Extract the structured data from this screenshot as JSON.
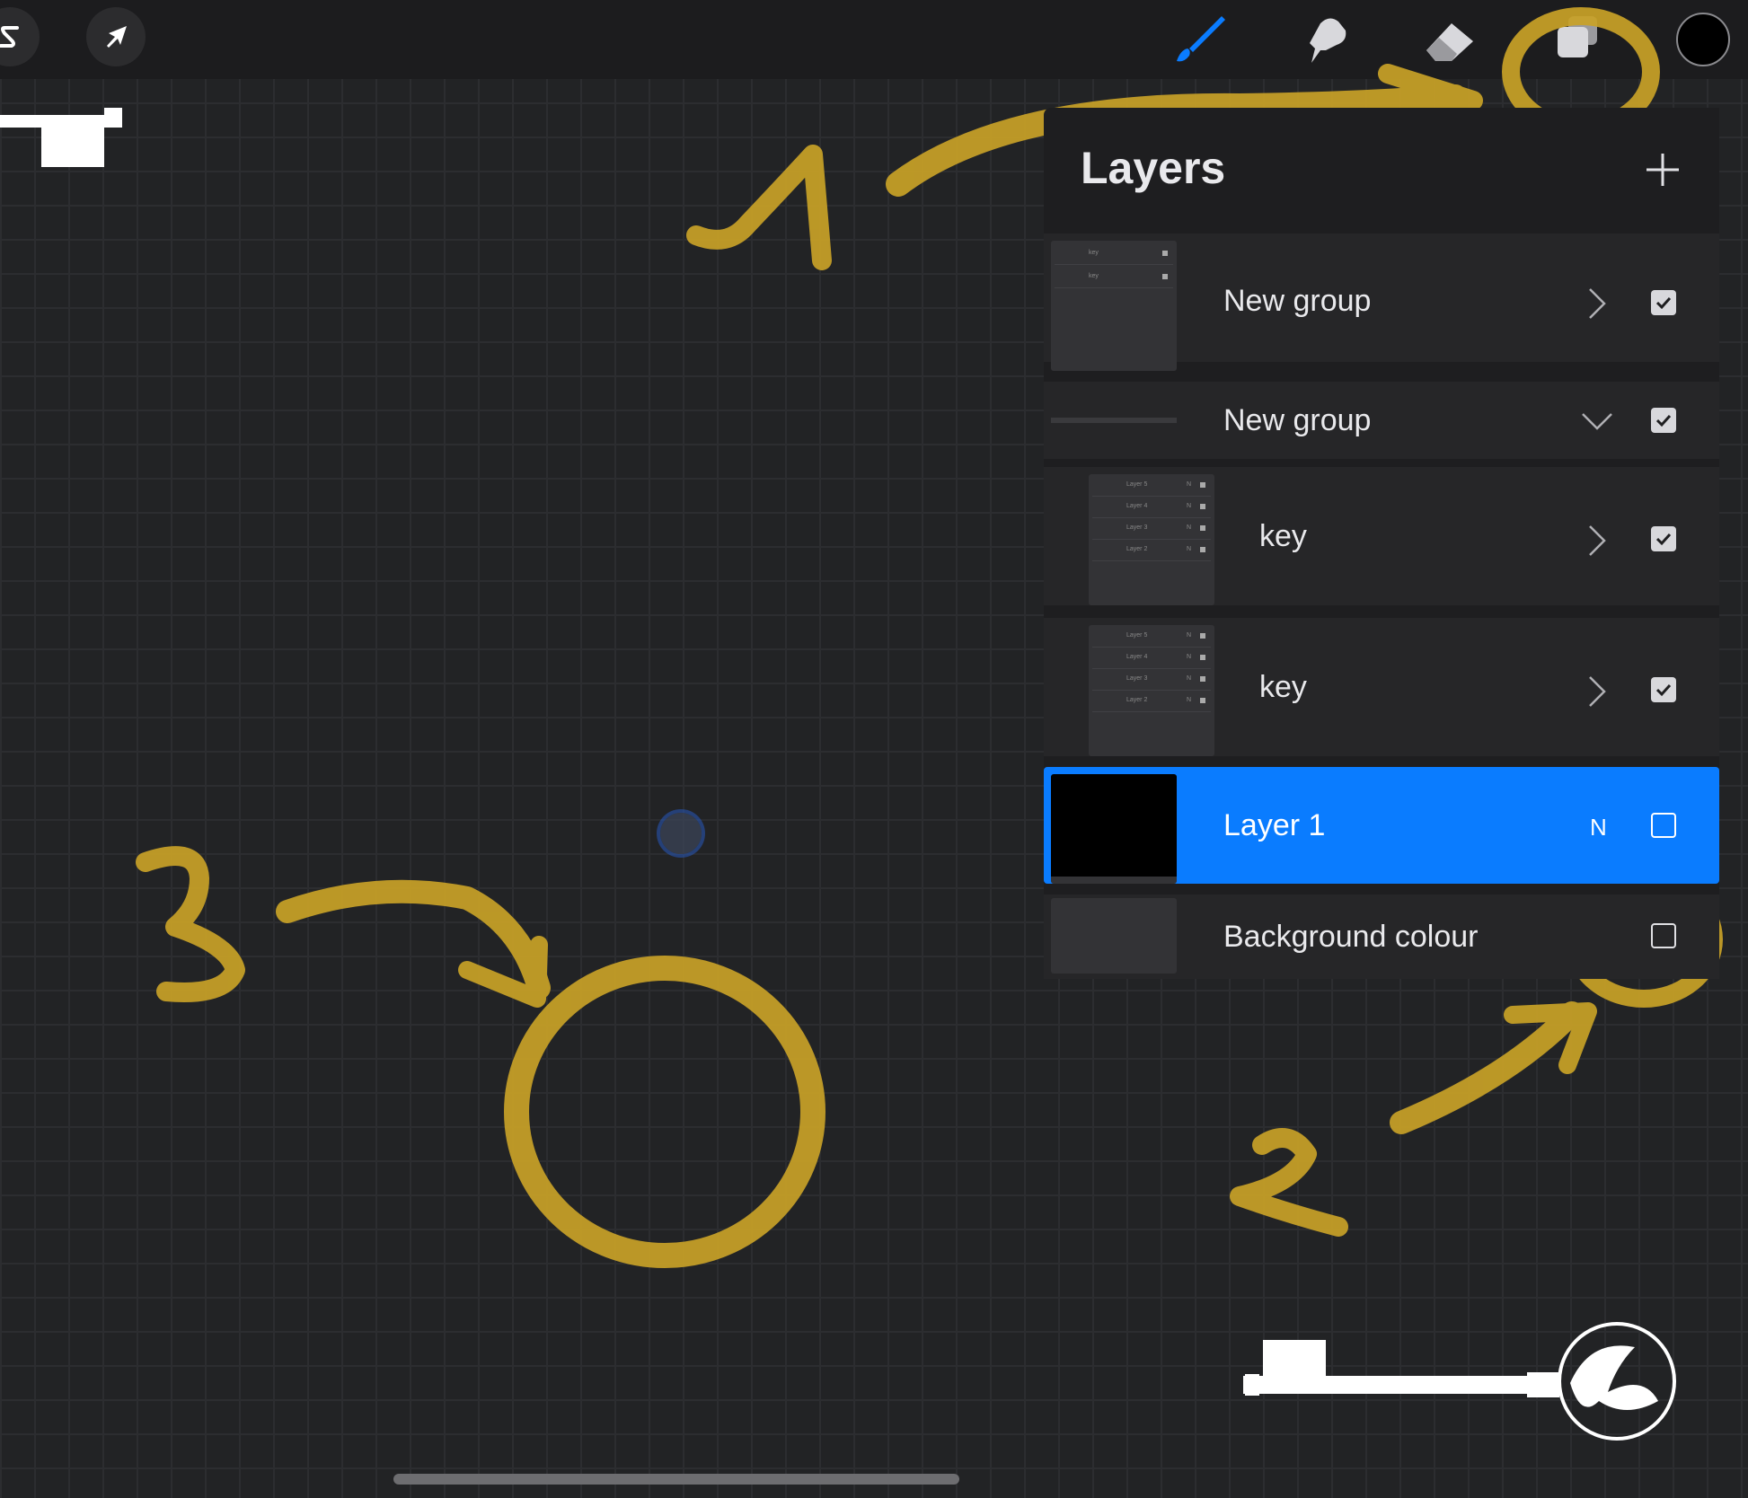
{
  "toolbar": {
    "left_tools": [
      "selection-tool",
      "transform-tool"
    ],
    "right_tools": [
      "brush-tool",
      "smudge-tool",
      "eraser-tool",
      "layers-tool"
    ],
    "active_tool": "brush-tool",
    "current_color": "#000000"
  },
  "layers_panel": {
    "title": "Layers",
    "add_label": "+",
    "layers": [
      {
        "name": "New group",
        "type": "group",
        "expanded": false,
        "visible": true,
        "mini_rows": [
          "key",
          "key"
        ]
      },
      {
        "name": "New group",
        "type": "group",
        "expanded": true,
        "visible": true
      },
      {
        "name": "key",
        "type": "group",
        "expanded": false,
        "visible": true,
        "indent": true,
        "mini_rows": [
          "Layer 5",
          "Layer 4",
          "Layer 3",
          "Layer 2"
        ],
        "mini_n": "N"
      },
      {
        "name": "key",
        "type": "group",
        "expanded": false,
        "visible": true,
        "indent": true,
        "mini_rows": [
          "Layer 5",
          "Layer 4",
          "Layer 3",
          "Layer 2"
        ],
        "mini_n": "N"
      },
      {
        "name": "Layer 1",
        "type": "layer",
        "blend_mode": "N",
        "visible": false,
        "selected": true
      },
      {
        "name": "Background colour",
        "type": "background",
        "visible": false
      }
    ]
  },
  "annotations": {
    "stroke_color": "#c9a227",
    "numbers": [
      "1",
      "2",
      "3"
    ]
  }
}
